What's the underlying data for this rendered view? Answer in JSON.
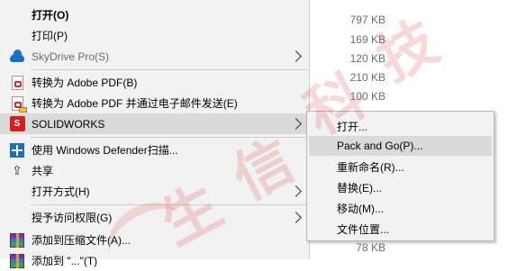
{
  "context_menu": {
    "items": [
      {
        "label": "打开(O)",
        "icon": "none"
      },
      {
        "label": "打印(P)",
        "icon": "none"
      },
      {
        "label": "SkyDrive Pro(S)",
        "icon": "skydrive-cloud-icon"
      },
      {
        "label": "转换为 Adobe PDF(B)",
        "icon": "adobe-pdf-icon"
      },
      {
        "label": "转换为 Adobe PDF 并通过电子邮件发送(E)",
        "icon": "adobe-pdf-mail-icon"
      },
      {
        "label": "SOLIDWORKS",
        "icon": "solidworks-icon"
      },
      {
        "label": "使用 Windows Defender扫描...",
        "icon": "windows-defender-icon"
      },
      {
        "label": "共享",
        "icon": "share-icon"
      },
      {
        "label": "打开方式(H)",
        "icon": "none"
      },
      {
        "label": "授予访问权限(G)",
        "icon": "none"
      },
      {
        "label": "添加到压缩文件(A)...",
        "icon": "winrar-icon"
      },
      {
        "label": "添加到 \"...\"(T)",
        "icon": "winrar-icon"
      }
    ]
  },
  "solidworks_submenu": {
    "items": [
      {
        "label": "打开..."
      },
      {
        "label": "Pack and Go(P)..."
      },
      {
        "label": "重新命名(R)..."
      },
      {
        "label": "替换(E)..."
      },
      {
        "label": "移动(M)..."
      },
      {
        "label": "文件位置..."
      }
    ]
  },
  "file_list": {
    "sizes": [
      "797 KB",
      "169 KB",
      "120 KB",
      "210 KB",
      "100 KB",
      "78 KB"
    ]
  },
  "watermark": {
    "chars": [
      "生",
      "信",
      "科",
      "技"
    ]
  },
  "colors": {
    "menu_bg": "#f2f2f2",
    "highlight": "#dadada",
    "solidworks_red": "#d21f24",
    "adobe_red": "#d7262d",
    "watermark": "#e15050"
  }
}
